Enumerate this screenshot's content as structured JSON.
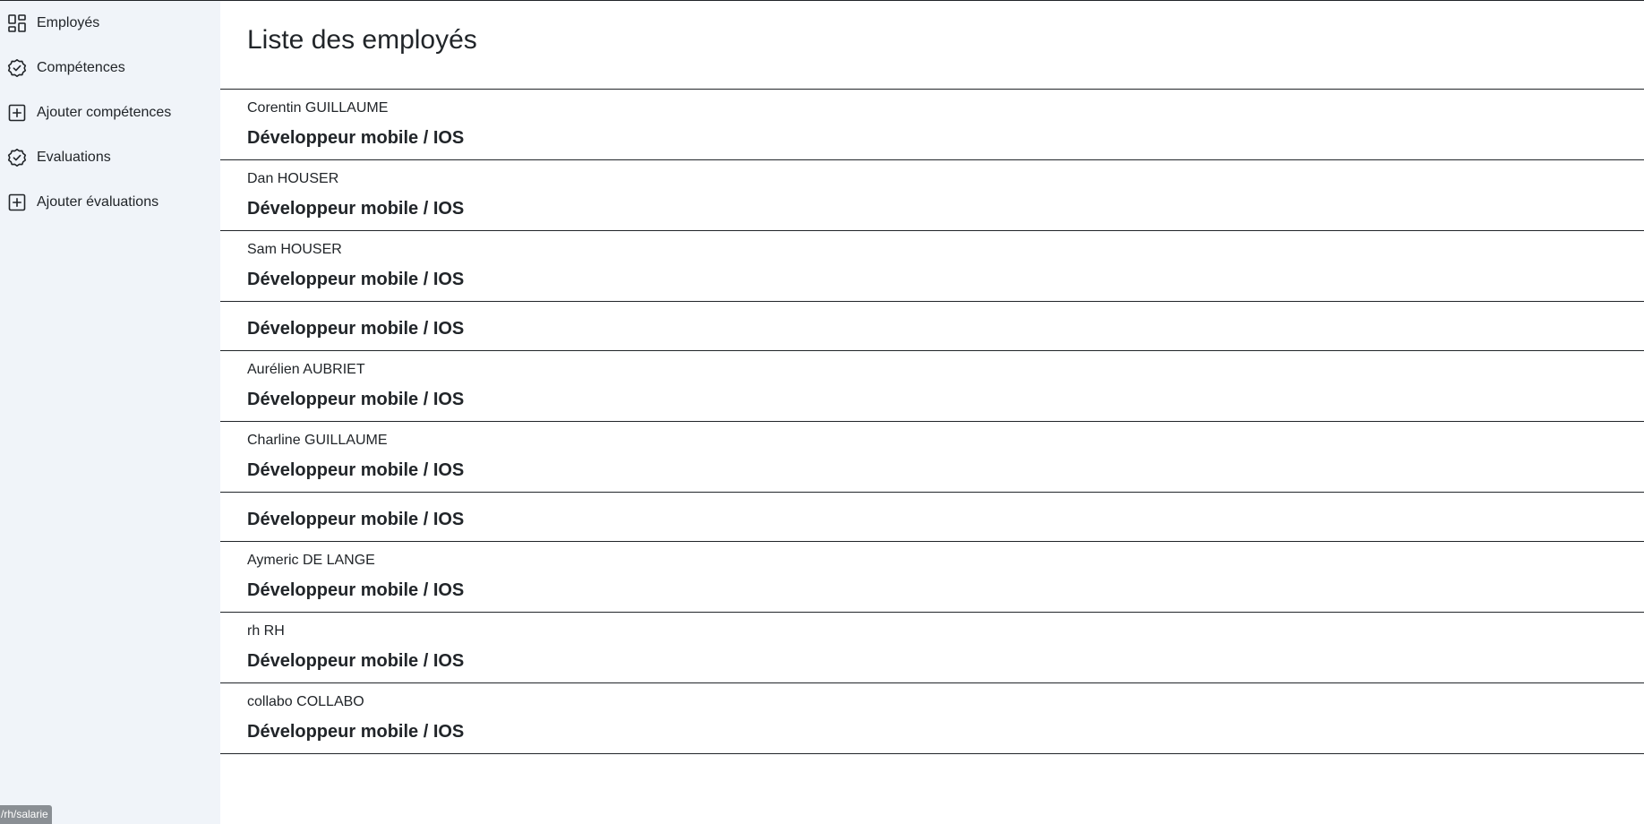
{
  "sidebar": {
    "items": [
      {
        "label": "Employés",
        "icon": "dashboard-icon"
      },
      {
        "label": "Compétences",
        "icon": "check-badge-icon"
      },
      {
        "label": "Ajouter compétences",
        "icon": "plus-square-icon"
      },
      {
        "label": "Evaluations",
        "icon": "check-badge-icon"
      },
      {
        "label": "Ajouter évaluations",
        "icon": "plus-square-icon"
      }
    ]
  },
  "status_bar": {
    "url": "/rh/salarie"
  },
  "main": {
    "title": "Liste des employés",
    "employees": [
      {
        "name": "Corentin GUILLAUME",
        "role": "Développeur mobile / IOS"
      },
      {
        "name": "Dan HOUSER",
        "role": "Développeur mobile / IOS"
      },
      {
        "name": "Sam HOUSER",
        "role": "Développeur mobile / IOS"
      },
      {
        "name": "",
        "role": "Développeur mobile / IOS"
      },
      {
        "name": "Aurélien AUBRIET",
        "role": "Développeur mobile / IOS"
      },
      {
        "name": "Charline GUILLAUME",
        "role": "Développeur mobile / IOS"
      },
      {
        "name": "",
        "role": "Développeur mobile / IOS"
      },
      {
        "name": "Aymeric DE LANGE",
        "role": "Développeur mobile / IOS"
      },
      {
        "name": "rh RH",
        "role": "Développeur mobile / IOS"
      },
      {
        "name": "collabo COLLABO",
        "role": "Développeur mobile / IOS"
      }
    ]
  },
  "colors": {
    "sidebar_bg": "#f0f4f9",
    "text": "#212529",
    "divider": "#212529",
    "status_bg": "#8a8f94"
  }
}
